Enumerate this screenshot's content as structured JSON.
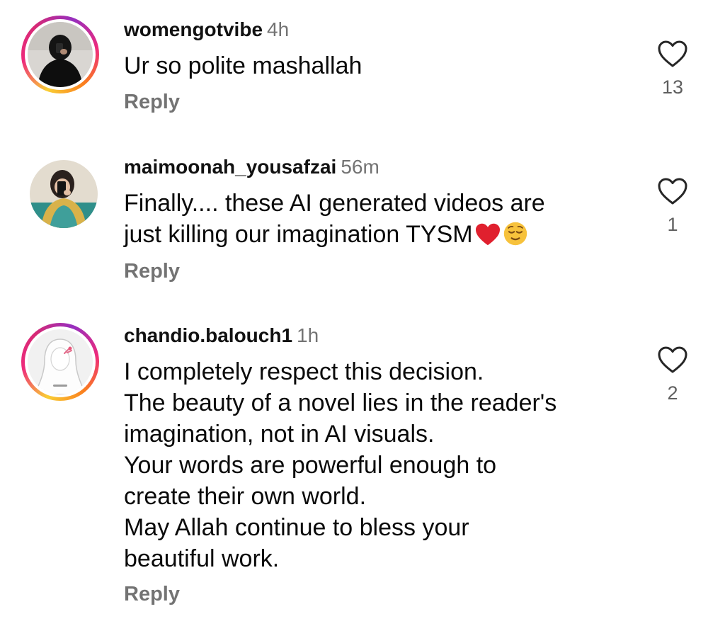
{
  "comments": [
    {
      "username": "womengotvibe",
      "time": "4h",
      "lines": [
        "Ur so polite mashallah"
      ],
      "reply_label": "Reply",
      "likes": "13",
      "avatar_icon": "profile-photo-black-outfit",
      "story_ring": true
    },
    {
      "username": "maimoonah_yousafzai",
      "time": "56m",
      "lines": [
        "Finally.... these AI generated videos are",
        "just killing our imagination TYSM"
      ],
      "emojis": [
        "heart-emoji",
        "relieved-face-emoji"
      ],
      "reply_label": "Reply",
      "likes": "1",
      "avatar_icon": "profile-photo-mirror-selfie",
      "story_ring": false
    },
    {
      "username": "chandio.balouch1",
      "time": "1h",
      "lines": [
        "I completely respect this decision.",
        "The beauty of a novel lies in the reader's",
        "imagination, not in AI visuals.",
        "Your words are powerful enough to",
        "create their own world.",
        "May Allah continue to bless your",
        "beautiful work."
      ],
      "reply_label": "Reply",
      "likes": "2",
      "avatar_icon": "profile-illustration-hijab",
      "story_ring": true
    }
  ],
  "colors": {
    "username": "#111111",
    "meta_gray": "#737373",
    "heart_outline": "#262626",
    "emoji_heart": "#e0202e",
    "emoji_face": "#f7c23c"
  }
}
